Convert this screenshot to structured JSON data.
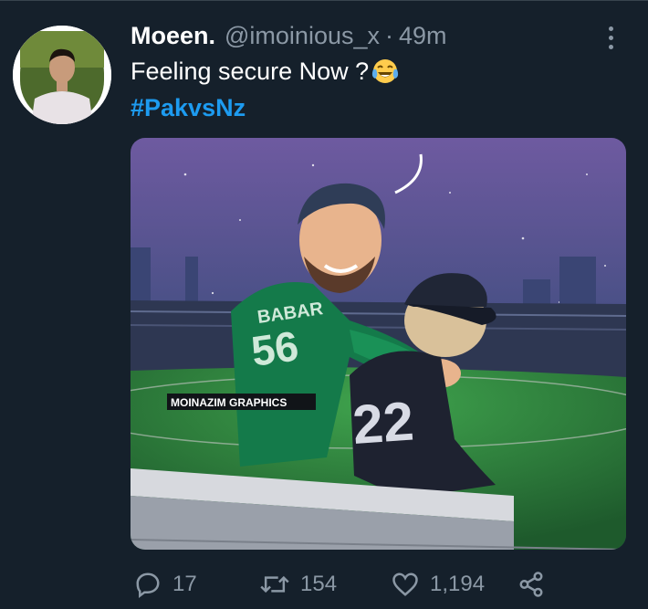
{
  "tweet": {
    "author": {
      "display_name": "Moeen.",
      "handle": "@imoinious_x",
      "separator": "·",
      "time": "49m",
      "avatar_icon": "user-avatar"
    },
    "text": "Feeling secure Now ?",
    "emoji": "face-with-tears-of-joy",
    "hashtag": "#PakvsNz",
    "media": {
      "watermark": "MOINAZIM GRAPHICS",
      "jersey_green_name": "BABAR",
      "jersey_green_number": "56",
      "jersey_black_number": "22"
    },
    "actions": {
      "replies": "17",
      "retweets": "154",
      "likes": "1,194"
    }
  },
  "colors": {
    "background": "#15202b",
    "text_primary": "#ffffff",
    "text_secondary": "#8b98a5",
    "link": "#1d9bf0"
  }
}
